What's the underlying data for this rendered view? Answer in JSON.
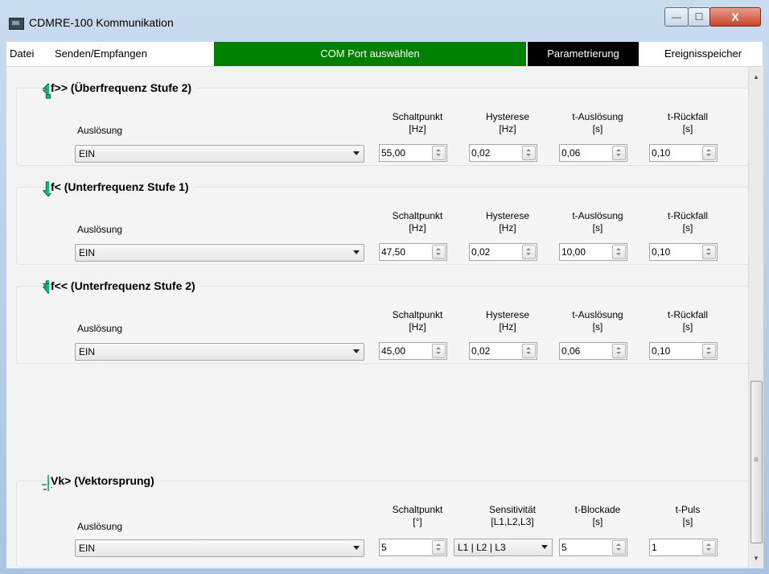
{
  "window": {
    "title": "CDMRE-100 Kommunikation",
    "min_label": "—",
    "max_label": "☐",
    "close_label": "X"
  },
  "menu": {
    "datei": "Datei",
    "senden": "Senden/Empfangen",
    "com_port": "COM Port auswählen",
    "param": "Parametrierung",
    "ereignis": "Ereignisspeicher"
  },
  "colors": {
    "com_port_bg": "#008000",
    "param_bg": "#000000",
    "icon_green": "#00a060"
  },
  "groups": [
    {
      "title": "f>> (Überfrequenz Stufe 2)",
      "icon": "double-arrow-up-icon",
      "ausl_label": "Auslösung",
      "ausl_value": "EIN",
      "headers": [
        [
          "Schaltpunkt",
          "[Hz]"
        ],
        [
          "Hysterese",
          "[Hz]"
        ],
        [
          "t-Auslösung",
          "[s]"
        ],
        [
          "t-Rückfall",
          "[s]"
        ]
      ],
      "values": [
        "55,00",
        "0,02",
        "0,06",
        "0,10"
      ]
    },
    {
      "title": "f< (Unterfrequenz Stufe 1)",
      "icon": "arrow-down-icon",
      "ausl_label": "Auslösung",
      "ausl_value": "EIN",
      "headers": [
        [
          "Schaltpunkt",
          "[Hz]"
        ],
        [
          "Hysterese",
          "[Hz]"
        ],
        [
          "t-Auslösung",
          "[s]"
        ],
        [
          "t-Rückfall",
          "[s]"
        ]
      ],
      "values": [
        "47,50",
        "0,02",
        "10,00",
        "0,10"
      ]
    },
    {
      "title": "f<< (Unterfrequenz Stufe 2)",
      "icon": "double-arrow-down-icon",
      "ausl_label": "Auslösung",
      "ausl_value": "EIN",
      "headers": [
        [
          "Schaltpunkt",
          "[Hz]"
        ],
        [
          "Hysterese",
          "[Hz]"
        ],
        [
          "t-Auslösung",
          "[s]"
        ],
        [
          "t-Rückfall",
          "[s]"
        ]
      ],
      "values": [
        "45,00",
        "0,02",
        "0,06",
        "0,10"
      ]
    },
    {
      "title": "Vk> (Vektorsprung)",
      "icon": "vector-jump-icon",
      "ausl_label": "Auslösung",
      "ausl_value": "EIN",
      "headers": [
        [
          "Schaltpunkt",
          "[°]"
        ],
        [
          "Sensitivität",
          "[L1,L2,L3]"
        ],
        [
          "t-Blockade",
          "[s]"
        ],
        [
          "t-Puls",
          "[s]"
        ]
      ],
      "values": [
        "5",
        "L1 | L2 | L3",
        "5",
        "1"
      ]
    }
  ]
}
